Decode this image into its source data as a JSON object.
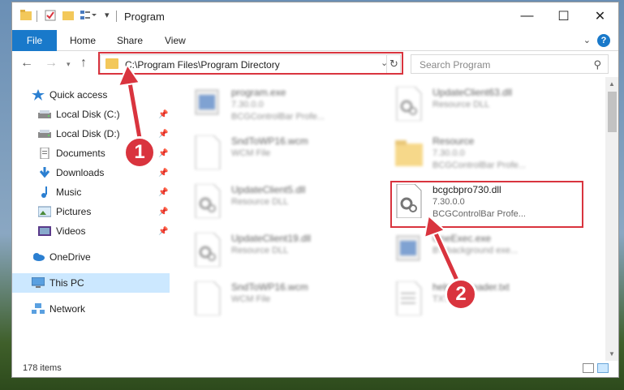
{
  "window": {
    "title": "Program",
    "buttons": {
      "minimize": "—",
      "maximize": "☐",
      "close": "✕"
    }
  },
  "ribbon": {
    "tabs": [
      "File",
      "Home",
      "Share",
      "View"
    ],
    "help": "?"
  },
  "nav": {
    "address": "C:\\Program Files\\Program Directory",
    "search_placeholder": "Search Program"
  },
  "sidebar": {
    "items": [
      {
        "label": "Quick access",
        "icon": "star-icon",
        "pinned": false
      },
      {
        "label": "Local Disk (C:)",
        "icon": "drive-icon",
        "pinned": true
      },
      {
        "label": "Local Disk (D:)",
        "icon": "drive-icon",
        "pinned": true
      },
      {
        "label": "Documents",
        "icon": "documents-icon",
        "pinned": true
      },
      {
        "label": "Downloads",
        "icon": "download-icon",
        "pinned": true
      },
      {
        "label": "Music",
        "icon": "music-icon",
        "pinned": true
      },
      {
        "label": "Pictures",
        "icon": "pictures-icon",
        "pinned": true
      },
      {
        "label": "Videos",
        "icon": "videos-icon",
        "pinned": true
      },
      {
        "label": "OneDrive",
        "icon": "cloud-icon",
        "pinned": false
      },
      {
        "label": "This PC",
        "icon": "computer-icon",
        "pinned": false,
        "selected": true
      },
      {
        "label": "Network",
        "icon": "network-icon",
        "pinned": false
      }
    ]
  },
  "files": [
    {
      "name": "program.exe",
      "line1": "7.30.0.0",
      "line2": "BCGControlBar Profe...",
      "icon": "exe-icon",
      "blurred": true
    },
    {
      "name": "UpdateClient63.dll",
      "line1": "Resource DLL",
      "line2": "",
      "icon": "dll-icon",
      "blurred": true
    },
    {
      "name": "SndToWP16.wcm",
      "line1": "WCM File",
      "line2": "",
      "icon": "file-icon",
      "blurred": true
    },
    {
      "name": "Resource",
      "line1": "7.30.0.0",
      "line2": "BCGControlBar Profe...",
      "icon": "folder-icon",
      "blurred": true
    },
    {
      "name": "UpdateClient5.dll",
      "line1": "Resource DLL",
      "line2": "",
      "icon": "dll-icon",
      "blurred": true
    },
    {
      "name": "bcgcbpro730.dll",
      "line1": "7.30.0.0",
      "line2": "BCGControlBar Profe...",
      "icon": "dll-icon",
      "blurred": false
    },
    {
      "name": "UpdateClient19.dll",
      "line1": "Resource DLL",
      "line2": "",
      "icon": "dll-icon",
      "blurred": true
    },
    {
      "name": "OneExec.exe",
      "line1": "BY background exe...",
      "line2": "",
      "icon": "exe-icon",
      "blurred": true
    },
    {
      "name": "SndToWP16.wcm",
      "line1": "WCM File",
      "line2": "",
      "icon": "file-icon",
      "blurred": true
    },
    {
      "name": "helper_Reader.txt",
      "line1": "TXT",
      "line2": "",
      "icon": "txt-icon",
      "blurred": true
    }
  ],
  "status": {
    "count": "178 items"
  },
  "annotations": {
    "one": "1",
    "two": "2"
  },
  "colors": {
    "accent": "#1979ca",
    "highlight": "#d9343e",
    "selected": "#cce8ff"
  }
}
